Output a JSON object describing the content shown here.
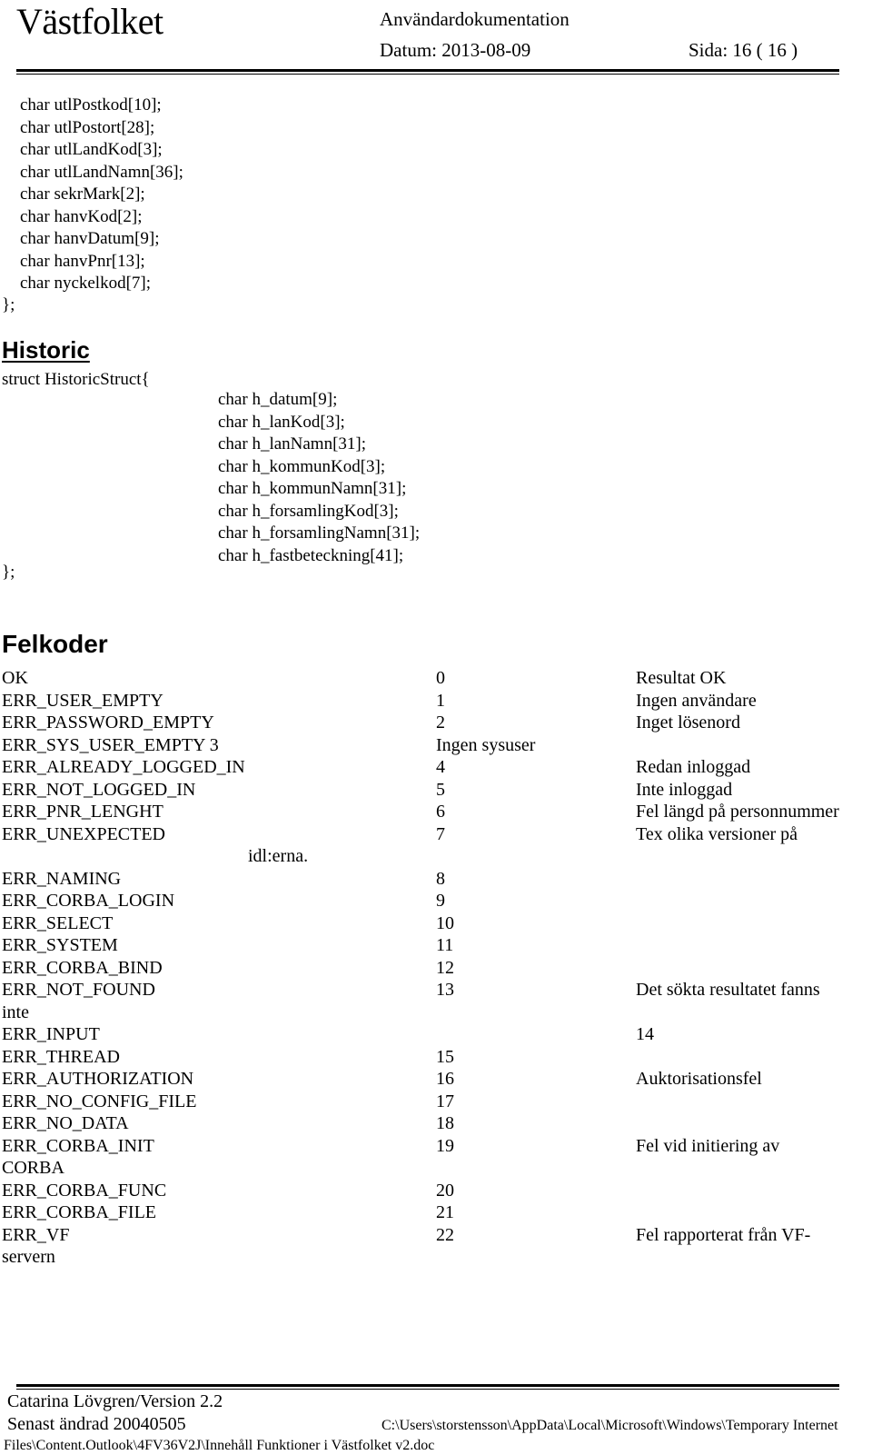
{
  "header": {
    "brand": "Västfolket",
    "doc_type": "Användardokumentation",
    "date_label": "Datum: 2013-08-09",
    "page_label": "Sida: 16 ( 16 )"
  },
  "struct_tail": {
    "lines": "char utlPostkod[10];\nchar utlPostort[28];\nchar utlLandKod[3];\nchar utlLandNamn[36];\nchar sekrMark[2];\nchar hanvKod[2];\nchar hanvDatum[9];\nchar hanvPnr[13];\nchar nyckelkod[7];",
    "close": "};"
  },
  "historic": {
    "heading": "Historic",
    "struct_line": "struct HistoricStruct{",
    "members": "char h_datum[9];\nchar h_lanKod[3];\nchar h_lanNamn[31];\nchar h_kommunKod[3];\nchar h_kommunNamn[31];\nchar h_forsamlingKod[3];\nchar h_forsamlingNamn[31];\nchar h_fastbeteckning[41];",
    "close": "};"
  },
  "felkoder": {
    "heading": "Felkoder",
    "rows": [
      {
        "name": "OK",
        "code": "0",
        "desc": "Resultat OK"
      },
      {
        "name": "ERR_USER_EMPTY",
        "code": "1",
        "desc": "Ingen användare"
      },
      {
        "name": "ERR_PASSWORD_EMPTY",
        "code": "2",
        "desc": "Inget lösenord"
      },
      {
        "name": "ERR_SYS_USER_EMPTY 3",
        "code": "",
        "desc": "Ingen sysuser",
        "desc_in_code_col": true
      },
      {
        "name": "ERR_ALREADY_LOGGED_IN",
        "code": "4",
        "desc": "Redan inloggad"
      },
      {
        "name": "ERR_NOT_LOGGED_IN",
        "code": "5",
        "desc": "Inte inloggad"
      },
      {
        "name": "ERR_PNR_LENGHT",
        "code": "6",
        "desc": "Fel längd på personnummer"
      },
      {
        "name": "ERR_UNEXPECTED",
        "code": "7",
        "desc": "Tex olika versioner på"
      },
      {
        "name": "idl:erna.",
        "code": "",
        "desc": "",
        "indent": true
      },
      {
        "name": "ERR_NAMING",
        "code": "8",
        "desc": ""
      },
      {
        "name": "ERR_CORBA_LOGIN",
        "code": "9",
        "desc": ""
      },
      {
        "name": "ERR_SELECT",
        "code": "10",
        "desc": ""
      },
      {
        "name": "ERR_SYSTEM",
        "code": "11",
        "desc": ""
      },
      {
        "name": "ERR_CORBA_BIND",
        "code": "12",
        "desc": ""
      },
      {
        "name": "ERR_NOT_FOUND",
        "code": "13",
        "desc": "Det sökta resultatet fanns"
      },
      {
        "name": "inte",
        "code": "",
        "desc": "",
        "continuation": true
      },
      {
        "name": "ERR_INPUT",
        "code": "14",
        "desc": "",
        "code_in_desc_col": true
      },
      {
        "name": "ERR_THREAD",
        "code": "15",
        "desc": ""
      },
      {
        "name": "ERR_AUTHORIZATION",
        "code": "16",
        "desc": "Auktorisationsfel"
      },
      {
        "name": "ERR_NO_CONFIG_FILE",
        "code": "17",
        "desc": ""
      },
      {
        "name": "ERR_NO_DATA",
        "code": "18",
        "desc": ""
      },
      {
        "name": "ERR_CORBA_INIT",
        "code": "19",
        "desc": "Fel vid initiering av"
      },
      {
        "name": "CORBA",
        "code": "",
        "desc": "",
        "continuation": true
      },
      {
        "name": "ERR_CORBA_FUNC",
        "code": "20",
        "desc": ""
      },
      {
        "name": "ERR_CORBA_FILE",
        "code": "21",
        "desc": ""
      },
      {
        "name": "ERR_VF",
        "code": "22",
        "desc": "Fel rapporterat från VF-"
      },
      {
        "name": "servern",
        "code": "",
        "desc": "",
        "continuation": true
      }
    ]
  },
  "footer": {
    "author": "Catarina Lövgren/Version 2.2",
    "changed": "Senast ändrad 20040505",
    "path_line1": "C:\\Users\\storstensson\\AppData\\Local\\Microsoft\\Windows\\Temporary Internet",
    "path_line2": "Files\\Content.Outlook\\4FV36V2J\\Innehåll Funktioner i Västfolket v2.doc"
  }
}
